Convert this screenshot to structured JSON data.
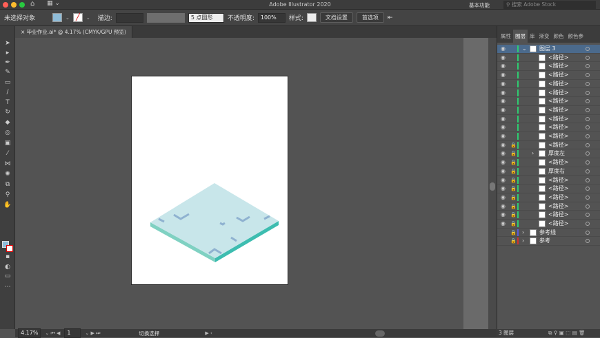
{
  "app": {
    "title": "Adobe Illustrator 2020",
    "workspace": "基本功能",
    "search_placeholder": "搜索 Adobe Stock"
  },
  "control": {
    "selection": "未选择对象",
    "stroke_label": "描边:",
    "brush": "5 点圆形",
    "opacity_label": "不透明度:",
    "opacity": "100%",
    "style_label": "样式:",
    "doc_setup": "文档设置",
    "prefs": "首选项"
  },
  "document": {
    "tab": "毕业作业.ai* @ 4.17% (CMYK/GPU 预览)"
  },
  "status": {
    "zoom": "4.17%",
    "page": "1",
    "mode": "切换选择"
  },
  "panel": {
    "tabs": [
      "属性",
      "图层",
      "库",
      "渐变",
      "颜色",
      "颜色参"
    ],
    "active_tab": 1,
    "layer_count": "3 图层",
    "rows": [
      {
        "label": "图层 3",
        "level": 0,
        "sel": true,
        "eye": true,
        "lock": false,
        "color": "#2ecc71",
        "expand": "open"
      },
      {
        "label": "<路径>",
        "level": 1,
        "eye": true,
        "lock": false,
        "color": "#2ecc71"
      },
      {
        "label": "<路径>",
        "level": 1,
        "eye": true,
        "lock": false,
        "color": "#2ecc71"
      },
      {
        "label": "<路径>",
        "level": 1,
        "eye": true,
        "lock": false,
        "color": "#2ecc71"
      },
      {
        "label": "<路径>",
        "level": 1,
        "eye": true,
        "lock": false,
        "color": "#2ecc71"
      },
      {
        "label": "<路径>",
        "level": 1,
        "eye": true,
        "lock": false,
        "color": "#2ecc71"
      },
      {
        "label": "<路径>",
        "level": 1,
        "eye": true,
        "lock": false,
        "color": "#2ecc71"
      },
      {
        "label": "<路径>",
        "level": 1,
        "eye": true,
        "lock": false,
        "color": "#2ecc71"
      },
      {
        "label": "<路径>",
        "level": 1,
        "eye": true,
        "lock": false,
        "color": "#2ecc71"
      },
      {
        "label": "<路径>",
        "level": 1,
        "eye": true,
        "lock": false,
        "color": "#2ecc71"
      },
      {
        "label": "<路径>",
        "level": 1,
        "eye": true,
        "lock": false,
        "color": "#2ecc71"
      },
      {
        "label": "<路径>",
        "level": 1,
        "eye": true,
        "lock": true,
        "color": "#2ecc71"
      },
      {
        "label": "厚度左",
        "level": 1,
        "eye": true,
        "lock": true,
        "color": "#2ecc71",
        "expand": "closed"
      },
      {
        "label": "<路径>",
        "level": 1,
        "eye": true,
        "lock": true,
        "color": "#2ecc71"
      },
      {
        "label": "厚度右",
        "level": 1,
        "eye": true,
        "lock": true,
        "color": "#2ecc71"
      },
      {
        "label": "<路径>",
        "level": 1,
        "eye": true,
        "lock": true,
        "color": "#2ecc71"
      },
      {
        "label": "<路径>",
        "level": 1,
        "eye": true,
        "lock": true,
        "color": "#2ecc71"
      },
      {
        "label": "<路径>",
        "level": 1,
        "eye": true,
        "lock": true,
        "color": "#2ecc71"
      },
      {
        "label": "<路径>",
        "level": 1,
        "eye": true,
        "lock": true,
        "color": "#2ecc71"
      },
      {
        "label": "<路径>",
        "level": 1,
        "eye": true,
        "lock": true,
        "color": "#2ecc71"
      },
      {
        "label": "<路径>",
        "level": 1,
        "eye": true,
        "lock": true,
        "color": "#2ecc71"
      },
      {
        "label": "参考线",
        "level": 0,
        "eye": false,
        "lock": true,
        "color": "#5a5adc",
        "expand": "closed"
      },
      {
        "label": "参考",
        "level": 0,
        "eye": false,
        "lock": true,
        "color": "#d03030",
        "expand": "closed"
      }
    ]
  },
  "colors": {
    "fill": "#8fbcd8",
    "top": "#c8e6ea",
    "side_left": "#7fd1c2",
    "side_right": "#3dbdb0",
    "notch": "#8fb2d0"
  }
}
